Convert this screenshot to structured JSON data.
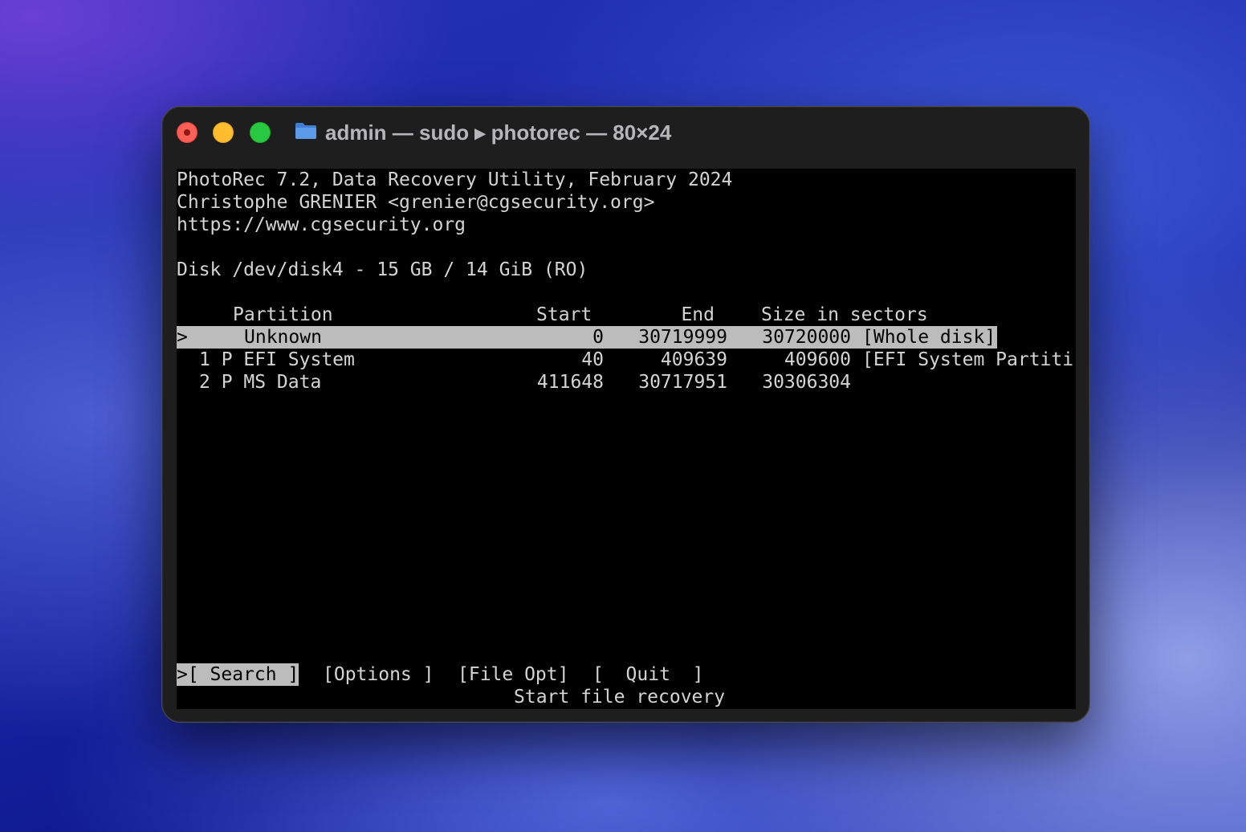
{
  "window": {
    "title": "admin — sudo ▸ photorec — 80×24"
  },
  "terminal": {
    "header": [
      "PhotoRec 7.2, Data Recovery Utility, February 2024",
      "Christophe GRENIER <grenier@cgsecurity.org>",
      "https://www.cgsecurity.org"
    ],
    "disk_line": "Disk /dev/disk4 - 15 GB / 14 GiB (RO)",
    "columns": {
      "partition": "Partition",
      "start": "Start",
      "end": "End",
      "size": "Size in sectors"
    },
    "rows": [
      {
        "cursor": ">",
        "name": "Unknown",
        "start": "0",
        "end": "30719999",
        "size": "30720000",
        "note": "[Whole disk]",
        "selected": true
      },
      {
        "cursor": "",
        "name": "1 P EFI System",
        "start": "40",
        "end": "409639",
        "size": "409600",
        "note": "[EFI System Partiti",
        "selected": false
      },
      {
        "cursor": "",
        "name": "2 P MS Data",
        "start": "411648",
        "end": "30717951",
        "size": "30306304",
        "note": "",
        "selected": false
      }
    ],
    "menu": {
      "search": ">[ Search ]",
      "options": "[Options ]",
      "file_opt": "[File Opt]",
      "quit": "[  Quit  ]"
    },
    "hint": "Start file recovery"
  },
  "colors": {
    "terminal_bg": "#000000",
    "terminal_fg": "#d4d4d4",
    "selection_bg": "#bcbcbc",
    "close": "#fe5f57",
    "minimize": "#febc2e",
    "zoom": "#28c840"
  }
}
